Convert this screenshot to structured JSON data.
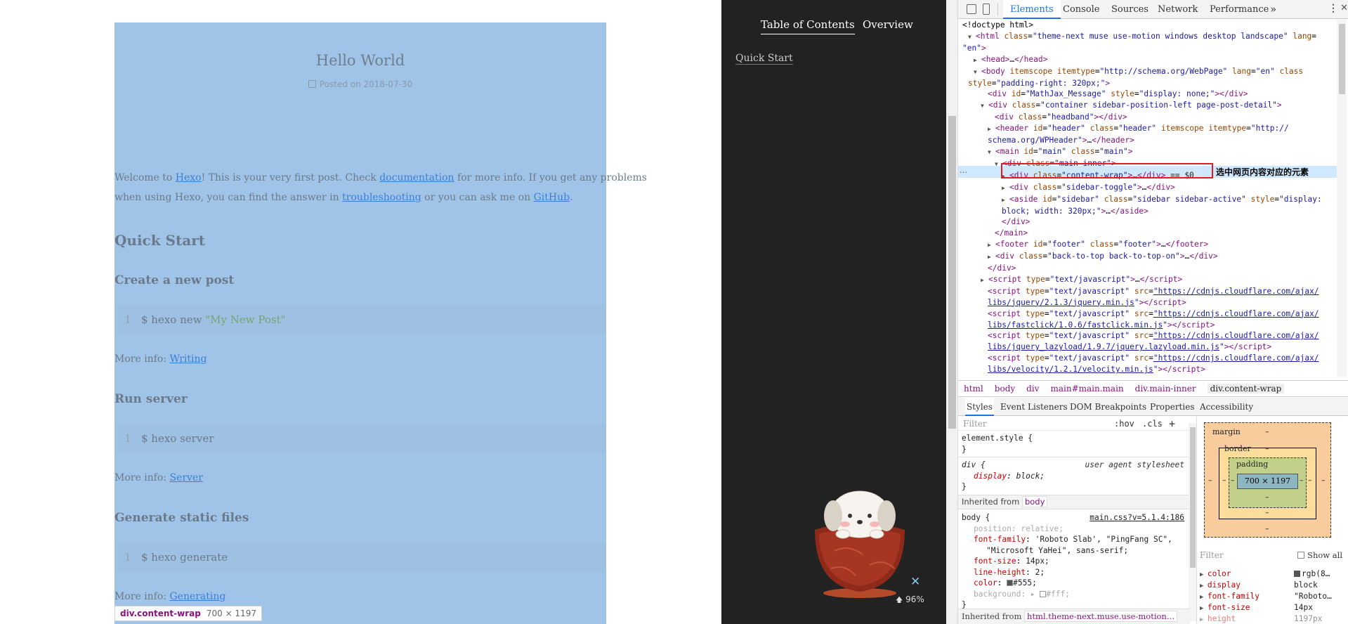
{
  "page": {
    "title": "Hello World",
    "meta": "Posted on 2018-07-30",
    "intro": {
      "p1": "Welcome to ",
      "link1": "Hexo",
      "p2": "! This is your very first post. Check ",
      "link2": "documentation",
      "p3": " for more info. If you get any problems",
      "p4": "when using Hexo, you can find the answer in ",
      "link3": "troubleshooting",
      "p5": " or you can ask me on ",
      "link4": "GitHub",
      "p6": "."
    },
    "h_quick": "Quick Start",
    "sections": [
      {
        "heading": "Create a new post",
        "line": "1",
        "cmd": "$ hexo new ",
        "str": "\"My New Post\"",
        "info": "More info: ",
        "link": "Writing"
      },
      {
        "heading": "Run server",
        "line": "1",
        "cmd": "$ hexo server",
        "str": "",
        "info": "More info: ",
        "link": "Server"
      },
      {
        "heading": "Generate static files",
        "line": "1",
        "cmd": "$ hexo generate",
        "str": "",
        "info": "More info: ",
        "link": "Generating"
      }
    ],
    "tooltip": {
      "name": "div.content-wrap",
      "size": "700 × 1197"
    }
  },
  "sidebar": {
    "tab_toc": "Table of Contents",
    "tab_overview": "Overview",
    "toc_item": "Quick Start",
    "close": "✕",
    "progress": "96%",
    "progress_arrow": "🡅"
  },
  "devtools": {
    "tabs": [
      "Elements",
      "Console",
      "Sources",
      "Network",
      "Performance"
    ],
    "more": "»",
    "annotation": "选中网页内容对应的元素",
    "dom_dots": "…",
    "breadcrumb": [
      "html",
      "body",
      "div",
      "main#main.main",
      "div.main-inner",
      "div.content-wrap"
    ],
    "panel_tabs": [
      "Styles",
      "Event Listeners",
      "DOM Breakpoints",
      "Properties",
      "Accessibility"
    ],
    "filter_placeholder": "Filter",
    "filter_hov": ":hov",
    "filter_cls": ".cls",
    "filter_plus": "+",
    "box": {
      "margin": "margin",
      "border": "border",
      "padding": "padding",
      "content": "700 × 1197",
      "dash": "–"
    },
    "computed_filter": "Filter",
    "show_all": "Show all",
    "computed": [
      {
        "name": "color",
        "value": "rgb(8…"
      },
      {
        "name": "display",
        "value": "block"
      },
      {
        "name": "font-family",
        "value": "\"Roboto…"
      },
      {
        "name": "font-size",
        "value": "14px"
      },
      {
        "name": "height",
        "value": "1197px"
      }
    ],
    "inherited_body": "Inherited from",
    "inherited_body_tag": "body",
    "inherited_html": "Inherited from",
    "inherited_html_tag": "html.theme-next.muse.use-motion…",
    "styles_source": "main.css?v=5.1.4:186",
    "user_agent": "user agent stylesheet"
  }
}
